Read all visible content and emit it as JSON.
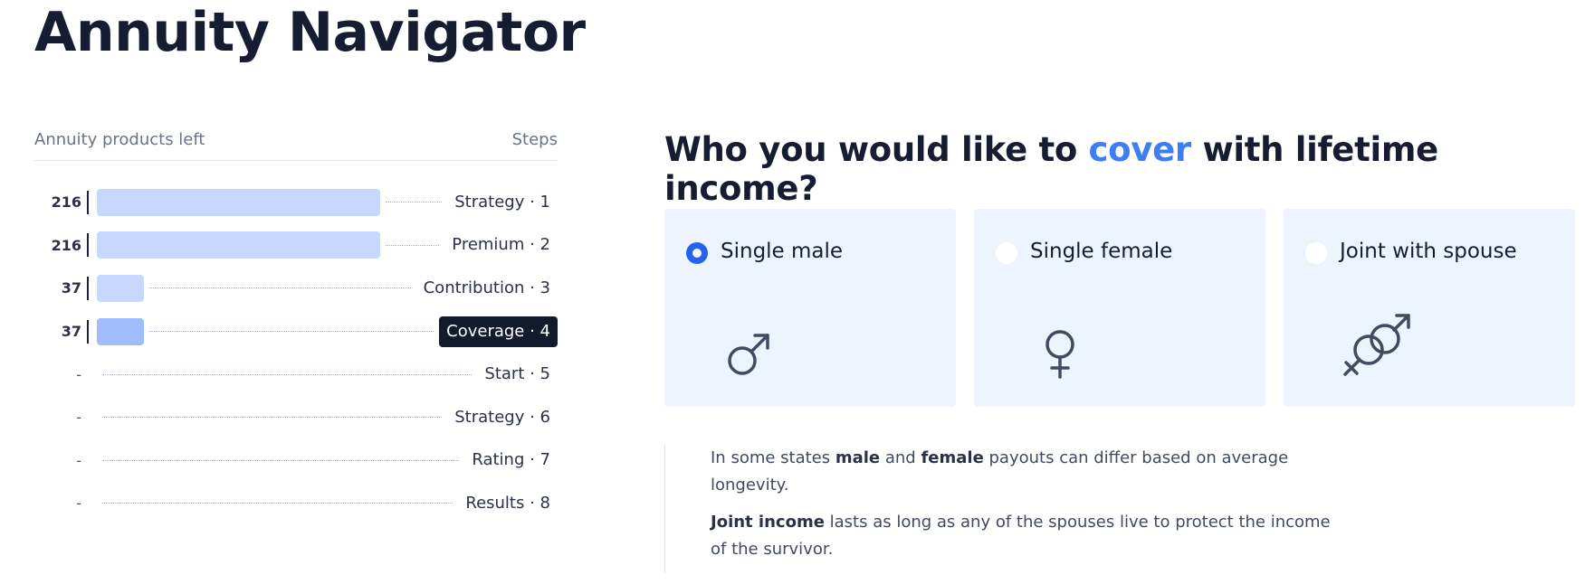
{
  "app": {
    "title": "Annuity Navigator"
  },
  "sidebar": {
    "left_header": "Annuity products left",
    "right_header": "Steps",
    "steps": [
      {
        "count": "216",
        "label": "Strategy · 1",
        "fill": 0.54,
        "active": false
      },
      {
        "count": "216",
        "label": "Premium · 2",
        "fill": 0.54,
        "active": false
      },
      {
        "count": "37",
        "label": "Contribution · 3",
        "fill": 0.09,
        "active": false
      },
      {
        "count": "37",
        "label": "Coverage · 4",
        "fill": 0.09,
        "active": true
      },
      {
        "count": "-",
        "label": "Start · 5",
        "fill": 0,
        "active": false
      },
      {
        "count": "-",
        "label": "Strategy · 6",
        "fill": 0,
        "active": false
      },
      {
        "count": "-",
        "label": "Rating · 7",
        "fill": 0,
        "active": false
      },
      {
        "count": "-",
        "label": "Results · 8",
        "fill": 0,
        "active": false
      }
    ]
  },
  "question": {
    "prefix": "Who you would like to ",
    "accent": "cover",
    "suffix": " with lifetime income?"
  },
  "options": [
    {
      "label": "Single male",
      "selected": true,
      "icon": "male-symbol-icon"
    },
    {
      "label": "Single female",
      "selected": false,
      "icon": "female-symbol-icon"
    },
    {
      "label": "Joint with spouse",
      "selected": false,
      "icon": "joint-gender-icon"
    }
  ],
  "info": {
    "p1_a": "In some states ",
    "p1_b": "male",
    "p1_c": " and ",
    "p1_d": "female",
    "p1_e": " payouts can differ based on average longevity.",
    "p2_a": "Joint income",
    "p2_b": " lasts as long as any of the spouses live to protect the income of the survivor."
  },
  "colors": {
    "accent": "#3d7df7",
    "bar": "#c6d8fd",
    "bar_active": "#9fbcfb",
    "card": "#eef4fe",
    "radio_selected": "#2563eb"
  }
}
